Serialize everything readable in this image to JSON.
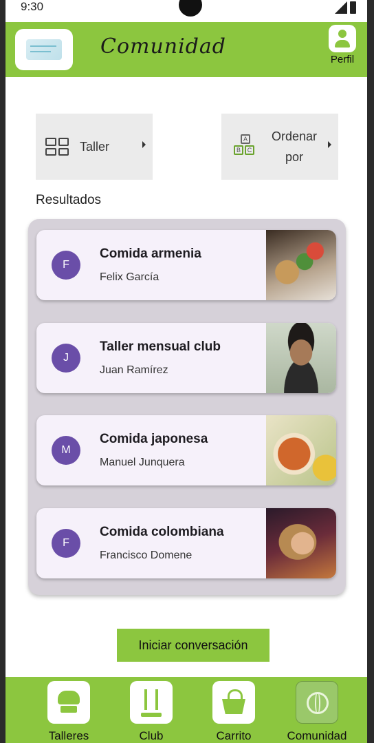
{
  "status_bar": {
    "time": "9:30"
  },
  "header": {
    "title": "Comunidad",
    "profile_label": "Perfil"
  },
  "filters": {
    "taller_label": "Taller",
    "ordenar_label": "Ordenar por"
  },
  "results": {
    "title": "Resultados",
    "items": [
      {
        "initial": "F",
        "title": "Comida armenia",
        "author": "Felix García",
        "image": "food-platter"
      },
      {
        "initial": "J",
        "title": "Taller mensual club",
        "author": "Juan Ramírez",
        "image": "person-portrait"
      },
      {
        "initial": "M",
        "title": "Comida japonesa",
        "author": "Manuel Junquera",
        "image": "noodle-bowl"
      },
      {
        "initial": "F",
        "title": "Comida colombiana",
        "author": "Francisco Domene",
        "image": "person-portrait"
      }
    ]
  },
  "cta": {
    "label": "Iniciar conversación"
  },
  "bottom_nav": {
    "items": [
      {
        "label": "Talleres",
        "icon": "chef-hat-icon"
      },
      {
        "label": "Club",
        "icon": "club-icon"
      },
      {
        "label": "Carrito",
        "icon": "basket-icon"
      },
      {
        "label": "Comunidad",
        "icon": "globe-icon",
        "active": true
      }
    ]
  },
  "colors": {
    "brand_green": "#8cc63f",
    "avatar_purple": "#6a4ea8",
    "card_bg": "#f6f1fa",
    "panel_bg": "#d6d1d9"
  }
}
